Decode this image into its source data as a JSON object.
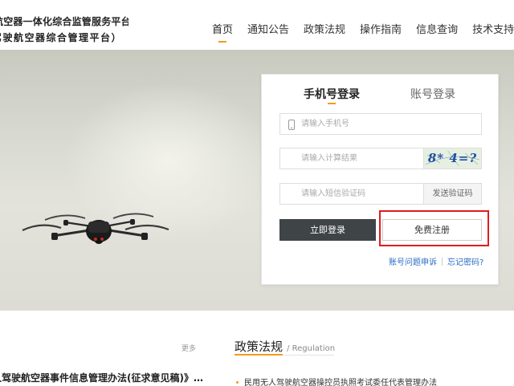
{
  "header": {
    "brand_line1": "航空器一体化综合监管服务平台",
    "brand_line2": "驾驶航空器综合管理平台）",
    "nav": [
      {
        "label": "首页",
        "active": true
      },
      {
        "label": "通知公告"
      },
      {
        "label": "政策法规"
      },
      {
        "label": "操作指南"
      },
      {
        "label": "信息查询"
      },
      {
        "label": "技术支持"
      }
    ]
  },
  "login": {
    "tab_phone": "手机号登录",
    "tab_account": "账号登录",
    "phone_placeholder": "请输入手机号",
    "captcha_placeholder": "请输入计算结果",
    "captcha_text": "8* 4=?",
    "sms_placeholder": "请输入短信验证码",
    "sms_button": "发送验证码",
    "login_button": "立即登录",
    "register_button": "免费注册",
    "link_appeal": "账号问题申诉",
    "link_forgot": "忘记密码?"
  },
  "news": {
    "more": "更多",
    "headline": "人驾驶航空器事件信息管理办法(征求意见稿)》…"
  },
  "policy": {
    "title": "政策法规",
    "subtitle": "/ Regulation",
    "items": [
      "民用无人驾驶航空器操控员执照考试委任代表管理办法"
    ]
  },
  "colors": {
    "accent": "#f29b1d",
    "login_button": "#3f4447",
    "highlight": "#e01c1c",
    "link": "#2a6cc7"
  }
}
